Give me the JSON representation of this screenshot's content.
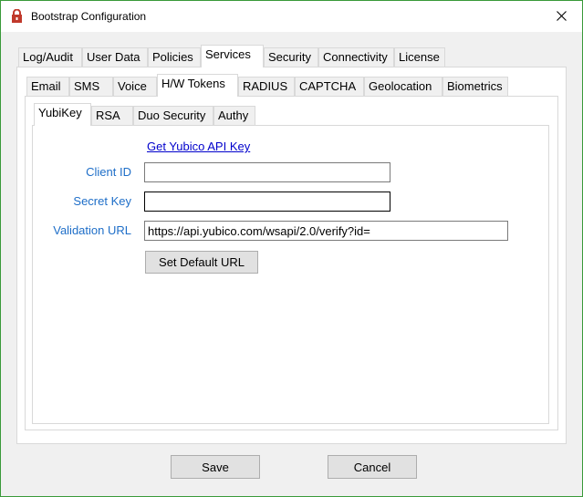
{
  "window": {
    "title": "Bootstrap Configuration",
    "close_icon": "close-icon",
    "app_icon": "lock-icon"
  },
  "main_tabs": [
    {
      "label": "Log/Audit"
    },
    {
      "label": "User Data"
    },
    {
      "label": "Policies"
    },
    {
      "label": "Services",
      "active": true
    },
    {
      "label": "Security"
    },
    {
      "label": "Connectivity"
    },
    {
      "label": "License"
    }
  ],
  "service_tabs": [
    {
      "label": "Email"
    },
    {
      "label": "SMS"
    },
    {
      "label": "Voice"
    },
    {
      "label": "H/W Tokens",
      "active": true
    },
    {
      "label": "RADIUS"
    },
    {
      "label": "CAPTCHA"
    },
    {
      "label": "Geolocation"
    },
    {
      "label": "Biometrics"
    }
  ],
  "token_tabs": [
    {
      "label": "YubiKey",
      "active": true
    },
    {
      "label": "RSA"
    },
    {
      "label": "Duo Security"
    },
    {
      "label": "Authy"
    }
  ],
  "yubikey": {
    "api_link": "Get Yubico API Key",
    "client_id_label": "Client ID",
    "client_id_value": "",
    "secret_key_label": "Secret Key",
    "secret_key_value": "",
    "validation_url_label": "Validation URL",
    "validation_url_value": "https://api.yubico.com/wsapi/2.0/verify?id=",
    "set_default_label": "Set Default URL"
  },
  "footer": {
    "save_label": "Save",
    "cancel_label": "Cancel"
  },
  "colors": {
    "label_blue": "#1e6ec8",
    "link_blue": "#0000cc",
    "window_border": "#3a9a3a"
  }
}
